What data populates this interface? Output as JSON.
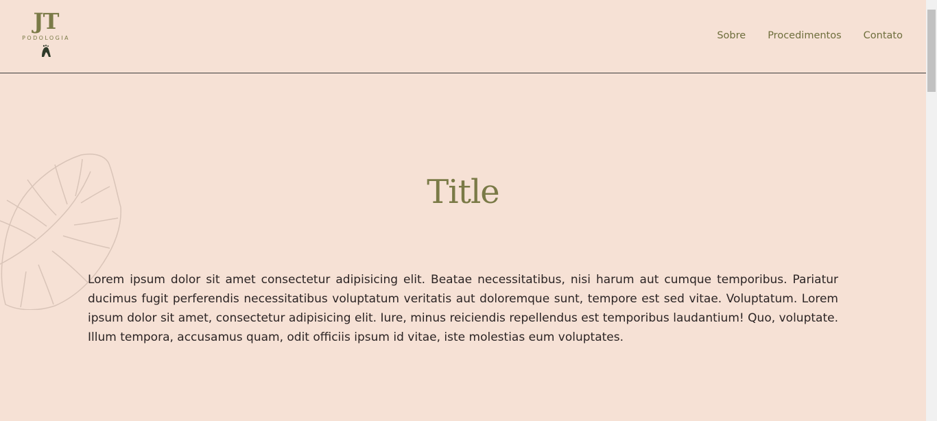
{
  "header": {
    "logo": {
      "mark": "JT",
      "subtitle": "PODOLOGIA",
      "icon": "foot-icon"
    },
    "nav": [
      {
        "label": "Sobre"
      },
      {
        "label": "Procedimentos"
      },
      {
        "label": "Contato"
      }
    ]
  },
  "main": {
    "decoration_icon": "monstera-leaf-icon",
    "title": "Title",
    "body": "Lorem ipsum dolor sit amet consectetur adipisicing elit. Beatae necessitatibus, nisi harum aut cumque temporibus. Pariatur ducimus fugit perferendis necessitatibus voluptatum veritatis aut doloremque sunt, tempore est sed vitae. Voluptatum. Lorem ipsum dolor sit amet, consectetur adipisicing elit. Iure, minus reiciendis repellendus est temporibus laudantium! Quo, voluptate. Illum tempora, accusamus quam, odit officiis ipsum id vitae, iste molestias eum voluptates."
  },
  "colors": {
    "background": "#f6e1d5",
    "accent": "#7a7a47",
    "text": "#2b2424"
  }
}
